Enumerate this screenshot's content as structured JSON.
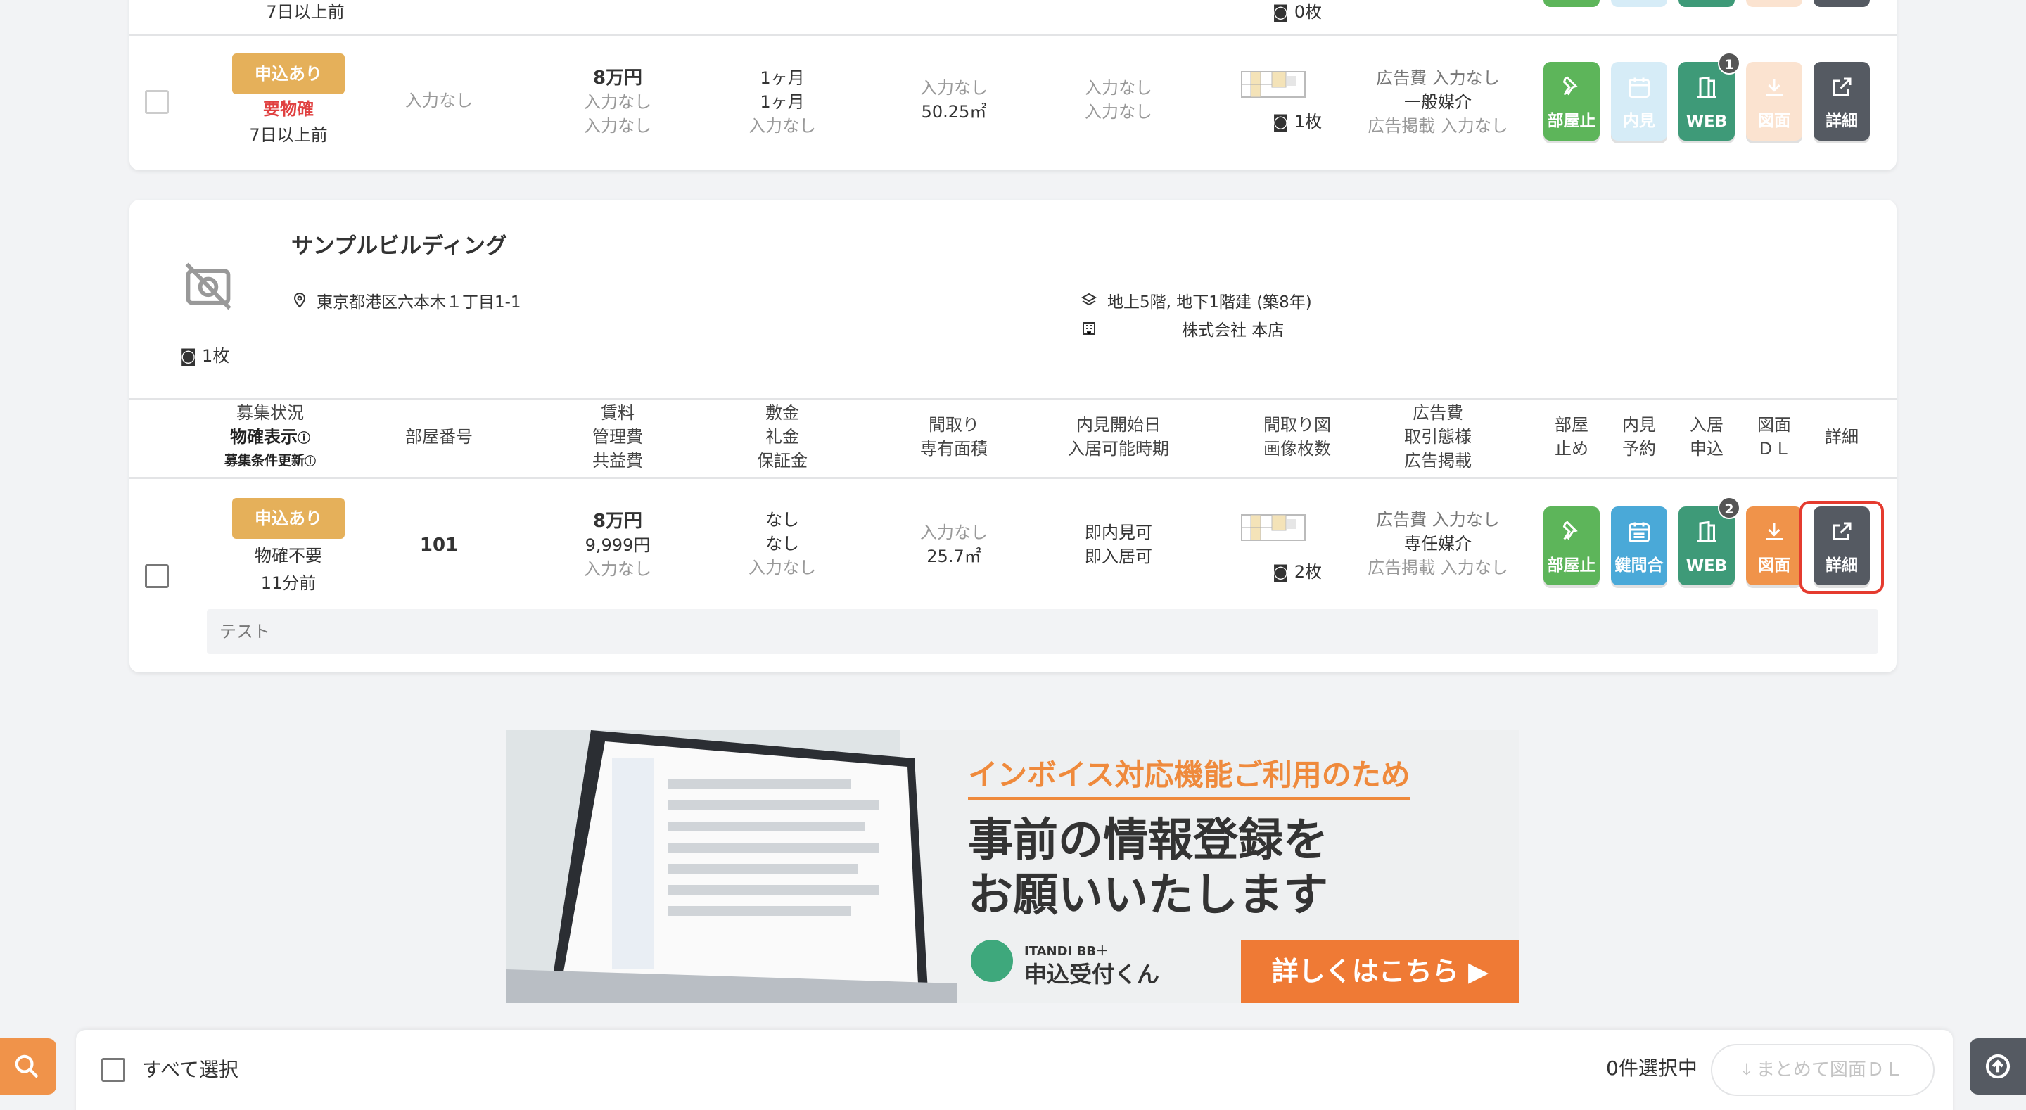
{
  "prev_listing": {
    "partial_status_time": "7日以上前",
    "partial_photo_count": "0枚",
    "status_badge": "申込あり",
    "confirm_note": "要物確",
    "updated": "7日以上前",
    "room_number": "入力なし",
    "rent": "8万円",
    "management_fee": "入力なし",
    "common_fee": "入力なし",
    "deposit": "1ヶ月",
    "key_money": "1ヶ月",
    "guarantee": "入力なし",
    "layout": "入力なし",
    "area": "50.25㎡",
    "viewing_start": "入力なし",
    "move_in": "入力なし",
    "photo_count": "1枚",
    "ad_fee": "広告費 入力なし",
    "brokerage": "一般媒介",
    "ad_listing": "広告掲載 入力なし",
    "actions": {
      "stop": "部屋止",
      "viewing": "内見",
      "web": "WEB",
      "web_count": "1",
      "plan": "図面",
      "detail": "詳細"
    }
  },
  "building": {
    "name": "サンプルビルディング",
    "address": "東京都港区六本木１丁目1-1",
    "floors": "地上5階, 地下1階建 (築8年)",
    "company": "株式会社 本店",
    "photo_count": "1枚"
  },
  "table_headers": {
    "status": [
      "募集状況",
      "物確表示",
      "募集条件更新"
    ],
    "room_number": "部屋番号",
    "rent": [
      "賃料",
      "管理費",
      "共益費"
    ],
    "deposit": [
      "敷金",
      "礼金",
      "保証金"
    ],
    "layout": [
      "間取り",
      "専有面積"
    ],
    "viewing": [
      "内見開始日",
      "入居可能時期"
    ],
    "plan": [
      "間取り図",
      "画像枚数"
    ],
    "ad": [
      "広告費",
      "取引態様",
      "広告掲載"
    ],
    "stop": [
      "部屋",
      "止め"
    ],
    "view_reserve": [
      "内見",
      "予約"
    ],
    "apply": [
      "入居",
      "申込"
    ],
    "drawing": [
      "図面",
      "ＤＬ"
    ],
    "detail": "詳細"
  },
  "room": {
    "status_badge": "申込あり",
    "confirm_note": "物確不要",
    "updated": "11分前",
    "room_number": "101",
    "rent": "8万円",
    "management_fee": "9,999円",
    "common_fee": "入力なし",
    "deposit": "なし",
    "key_money": "なし",
    "guarantee": "入力なし",
    "layout": "入力なし",
    "area": "25.7㎡",
    "viewing_start": "即内見可",
    "move_in": "即入居可",
    "photo_count": "2枚",
    "ad_fee": "広告費 入力なし",
    "brokerage": "専任媒介",
    "ad_listing": "広告掲載 入力なし",
    "note": "テスト",
    "actions": {
      "stop": "部屋止",
      "key": "鍵問合",
      "web": "WEB",
      "web_count": "2",
      "plan": "図面",
      "detail": "詳細"
    }
  },
  "banner": {
    "headline": "インボイス対応機能ご利用のため",
    "line1": "事前の情報登録を",
    "line2": "お願いいたします",
    "brand_small": "ITANDI BB＋",
    "brand": "申込受付くん",
    "cta": "詳しくはこちら ▶"
  },
  "bottom_bar": {
    "select_all": "すべて選択",
    "selected_count": "0件選択中",
    "bulk_download": "まとめて図面ＤＬ"
  },
  "colors": {
    "status_badge": "#e5b05a",
    "green": "#5db55a",
    "blue": "#4aa9d8",
    "teal": "#3e9a78",
    "orange": "#f0934a",
    "dark": "#555a62",
    "highlight": "#e53b2f"
  },
  "icons": [
    "pin-icon",
    "calendar-icon",
    "door-icon",
    "download-icon",
    "external-link-icon",
    "camera-icon",
    "location-icon",
    "layers-icon",
    "building-icon",
    "no-image-icon",
    "search-icon",
    "arrow-up-icon",
    "help-icon"
  ]
}
